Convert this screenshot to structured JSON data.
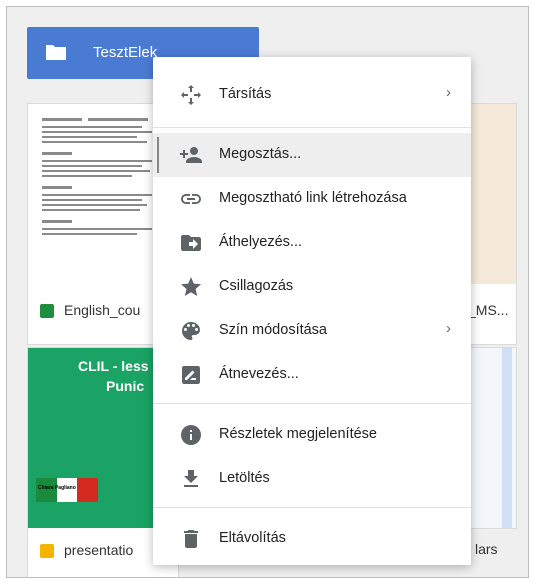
{
  "folder": {
    "name": "TesztElek"
  },
  "files": [
    {
      "name": "English_cou",
      "type": "sheets"
    },
    {
      "name": "_MS...",
      "type": "document"
    },
    {
      "name": "presentatio",
      "type": "slides"
    },
    {
      "name": "lars",
      "type": "document"
    }
  ],
  "slide_thumb": {
    "title": "CLIL - less",
    "subtitle": "Punic",
    "badge": "Chiara Pagliano"
  },
  "menu": {
    "items": [
      {
        "label": "Társítás",
        "icon": "move-icon",
        "submenu": true
      },
      {
        "label": "Megosztás...",
        "icon": "add-person-icon",
        "active": true
      },
      {
        "label": "Megosztható link létrehozása",
        "icon": "link-icon"
      },
      {
        "label": "Áthelyezés...",
        "icon": "move-to-folder-icon"
      },
      {
        "label": "Csillagozás",
        "icon": "star-icon"
      },
      {
        "label": "Szín módosítása",
        "icon": "palette-icon",
        "submenu": true
      },
      {
        "label": "Átnevezés...",
        "icon": "rename-icon"
      },
      {
        "label": "Részletek megjelenítése",
        "icon": "info-icon"
      },
      {
        "label": "Letöltés",
        "icon": "download-icon"
      },
      {
        "label": "Eltávolítás",
        "icon": "trash-icon"
      }
    ],
    "submenu_glyph": "›"
  },
  "colors": {
    "folder": "#4a7bd3",
    "sheets": "#1e8e3e",
    "slides": "#f4b400",
    "slide_bg": "#1aa364"
  }
}
